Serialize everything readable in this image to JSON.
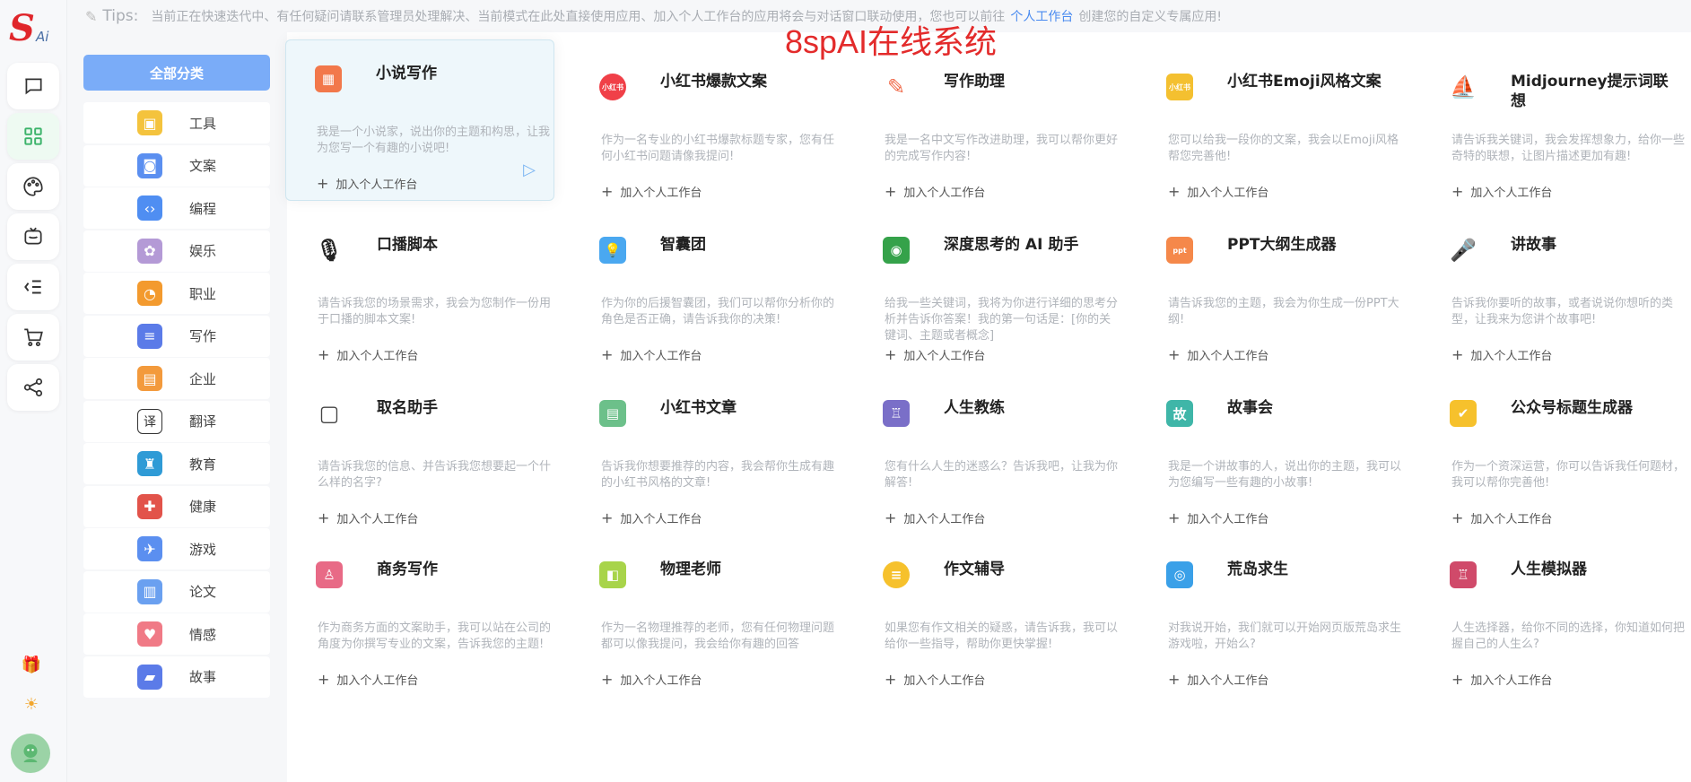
{
  "logo": {
    "letter": "S",
    "sub": "Ai"
  },
  "tips": {
    "lead": "Tips:",
    "text": "当前正在快速迭代中、有任何疑问请联系管理员处理解决、当前模式在此处直接使用应用、加入个人工作台的应用将会与对话窗口联动使用，您也可以前往",
    "link": "个人工作台",
    "tail": "创建您的自定义专属应用!"
  },
  "watermark": "8spAI在线系统",
  "rail": [
    {
      "name": "chat-icon"
    },
    {
      "name": "apps-grid-icon",
      "active": true
    },
    {
      "name": "palette-icon"
    },
    {
      "name": "robot-box-icon"
    },
    {
      "name": "list-indent-icon"
    },
    {
      "name": "cart-icon"
    },
    {
      "name": "share-icon"
    }
  ],
  "categories": {
    "all_label": "全部分类",
    "items": [
      {
        "label": "工具",
        "icon": "toolbox-icon",
        "color": "#f4c33d",
        "glyph": "▣"
      },
      {
        "label": "文案",
        "icon": "lock-doc-icon",
        "color": "#5b8ff0",
        "glyph": "◙"
      },
      {
        "label": "编程",
        "icon": "code-monitor-icon",
        "color": "#4f8ef2",
        "glyph": "‹›"
      },
      {
        "label": "娱乐",
        "icon": "entertainment-icon",
        "color": "#b49ad6",
        "glyph": "✿"
      },
      {
        "label": "职业",
        "icon": "career-clock-icon",
        "color": "#f39a2e",
        "glyph": "◔"
      },
      {
        "label": "写作",
        "icon": "writing-doc-icon",
        "color": "#5b7be8",
        "glyph": "≡"
      },
      {
        "label": "企业",
        "icon": "building-icon",
        "color": "#f39a3c",
        "glyph": "▤"
      },
      {
        "label": "翻译",
        "icon": "translate-icon",
        "color": "#333333",
        "glyph": "译"
      },
      {
        "label": "教育",
        "icon": "education-icon",
        "color": "#2f9bd6",
        "glyph": "♜"
      },
      {
        "label": "健康",
        "icon": "health-icon",
        "color": "#e2534a",
        "glyph": "✚"
      },
      {
        "label": "游戏",
        "icon": "game-icon",
        "color": "#5b8ff0",
        "glyph": "✈"
      },
      {
        "label": "论文",
        "icon": "paper-icon",
        "color": "#6aa0f0",
        "glyph": "▥"
      },
      {
        "label": "情感",
        "icon": "heart-icon",
        "color": "#f07a86",
        "glyph": "♥"
      },
      {
        "label": "故事",
        "icon": "story-book-icon",
        "color": "#5b7be8",
        "glyph": "▰"
      }
    ]
  },
  "add_label": "加入个人工作台",
  "cards": [
    {
      "title": "小说写作",
      "desc": "我是一个小说家，说出你的主题和构思，让我为您写一个有趣的小说吧!",
      "icon": "novel-icon",
      "color": "#f2784b",
      "glyph": "▦",
      "highlight": true
    },
    {
      "title": "小红书爆款文案",
      "desc": "作为一名专业的小红书爆款标题专家，您有任何小红书问题请像我提问!",
      "icon": "xiaohongshu-icon",
      "color": "#f04048",
      "glyph": "小红书"
    },
    {
      "title": "写作助理",
      "desc": "我是一名中文写作改进助理，我可以帮你更好的完成写作内容!",
      "icon": "edit-icon",
      "color": "#f06a4a",
      "glyph": "✎"
    },
    {
      "title": "小红书Emoji风格文案",
      "desc": "您可以给我一段你的文案，我会以Emoji风格帮您完善他!",
      "icon": "xiaohongshu-emoji-icon",
      "color": "#f4c030",
      "glyph": "小红书"
    },
    {
      "title": "Midjourney提示词联想",
      "desc": "请告诉我关键词，我会发挥想象力，给你一些奇特的联想，让图片描述更加有趣!",
      "icon": "sailboat-icon",
      "color": "#333333",
      "glyph": "⛵"
    },
    {
      "title": "口播脚本",
      "desc": "请告诉我您的场景需求，我会为您制作一份用于口播的脚本文案!",
      "icon": "microphone-icon",
      "color": "#222222",
      "glyph": "🎙"
    },
    {
      "title": "智囊团",
      "desc": "作为你的后援智囊团，我们可以帮你分析你的角色是否正确，请告诉我你的决策!",
      "icon": "lightbulb-icon",
      "color": "#4aa8f0",
      "glyph": "💡"
    },
    {
      "title": "深度思考的 AI 助手",
      "desc": "给我一些关键词，我将为你进行详细的思考分析并告诉你答案！我的第一句话是：[你的关键词、主题或者概念]",
      "icon": "ai-robot-icon",
      "color": "#35a24a",
      "glyph": "◉"
    },
    {
      "title": "PPT大纲生成器",
      "desc": "请告诉我您的主题，我会为你生成一份PPT大纲!",
      "icon": "ppt-icon",
      "color": "#f5884a",
      "glyph": "ppt"
    },
    {
      "title": "讲故事",
      "desc": "告诉我你要听的故事，或者说说你想听的类型，让我来为您讲个故事吧!",
      "icon": "mic-story-icon",
      "color": "#444444",
      "glyph": "🎤"
    },
    {
      "title": "取名助手",
      "desc": "请告诉我您的信息、并告诉我您想要起一个什么样的名字?",
      "icon": "name-card-icon",
      "color": "#444444",
      "glyph": "▢"
    },
    {
      "title": "小红书文章",
      "desc": "告诉我你想要推荐的内容，我会帮你生成有趣的小红书风格的文章!",
      "icon": "notebook-icon",
      "color": "#6cc08a",
      "glyph": "▤"
    },
    {
      "title": "人生教练",
      "desc": "您有什么人生的迷惑么？告诉我吧，让我为你解答!",
      "icon": "lighthouse-icon",
      "color": "#7a6fc8",
      "glyph": "♖"
    },
    {
      "title": "故事会",
      "desc": "我是一个讲故事的人，说出你的主题，我可以为您编写一些有趣的小故事!",
      "icon": "story-board-icon",
      "color": "#3fb6a8",
      "glyph": "故"
    },
    {
      "title": "公众号标题生成器",
      "desc": "作为一个资深运营，你可以告诉我任何题材，我可以帮你完善他!",
      "icon": "badge-check-icon",
      "color": "#f6c12c",
      "glyph": "✔"
    },
    {
      "title": "商务写作",
      "desc": "作为商务方面的文案助手，我可以站在公司的角度为你撰写专业的文案，告诉我您的主题!",
      "icon": "business-doc-icon",
      "color": "#e86a86",
      "glyph": "♙"
    },
    {
      "title": "物理老师",
      "desc": "作为一名物理推荐的老师，您有任何物理问题都可以像我提问，我会给你有趣的回答",
      "icon": "physics-book-icon",
      "color": "#a8d44a",
      "glyph": "◧"
    },
    {
      "title": "作文辅导",
      "desc": "如果您有作文相关的疑惑，请告诉我，我可以给你一些指导，帮助你更快掌握!",
      "icon": "essay-icon",
      "color": "#f6c12c",
      "glyph": "≡"
    },
    {
      "title": "荒岛求生",
      "desc": "对我说开始，我们就可以开始网页版荒岛求生游戏啦，开始么?",
      "icon": "lifebuoy-icon",
      "color": "#3aa0e8",
      "glyph": "◎"
    },
    {
      "title": "人生模拟器",
      "desc": "人生选择器，给你不同的选择，你知道如何把握自己的人生么?",
      "icon": "tower-icon",
      "color": "#d04a6a",
      "glyph": "♖"
    }
  ]
}
